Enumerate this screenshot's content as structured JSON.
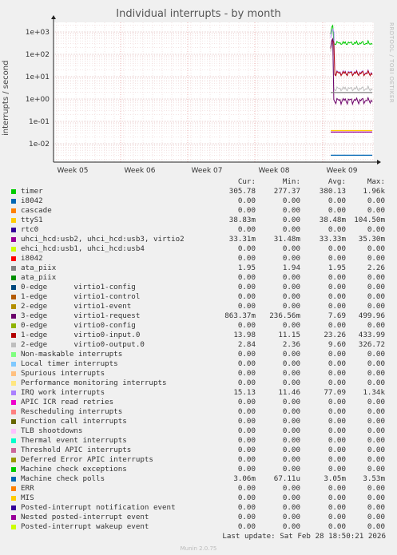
{
  "chart_data": {
    "type": "line",
    "title": "Individual interrupts - by month",
    "ylabel": "interrupts / second",
    "yscale": "log",
    "yticks": [
      "1e-02",
      "1e-01",
      "1e+00",
      "1e+01",
      "1e+02",
      "1e+03"
    ],
    "xticks": [
      "Week 05",
      "Week 06",
      "Week 07",
      "Week 08",
      "Week 09"
    ],
    "side_label": "RRDTOOL / TOBI OETIKER",
    "columns": [
      "Cur:",
      "Min:",
      "Avg:",
      "Max:"
    ],
    "series": [
      {
        "name": "timer",
        "color": "#00cc00",
        "cur": "305.78",
        "min": "277.37",
        "avg": "380.13",
        "max": "1.96k"
      },
      {
        "name": "i8042",
        "color": "#0066b3",
        "cur": "0.00",
        "min": "0.00",
        "avg": "0.00",
        "max": "0.00"
      },
      {
        "name": "cascade",
        "color": "#ff8000",
        "cur": "0.00",
        "min": "0.00",
        "avg": "0.00",
        "max": "0.00"
      },
      {
        "name": "ttyS1",
        "color": "#ffcc00",
        "cur": "38.83m",
        "min": "0.00",
        "avg": "38.48m",
        "max": "104.50m"
      },
      {
        "name": "rtc0",
        "color": "#330099",
        "cur": "0.00",
        "min": "0.00",
        "avg": "0.00",
        "max": "0.00"
      },
      {
        "name": "uhci_hcd:usb2, uhci_hcd:usb3, virtio2",
        "color": "#990099",
        "cur": "33.31m",
        "min": "31.48m",
        "avg": "33.33m",
        "max": "35.30m"
      },
      {
        "name": "ehci_hcd:usb1, uhci_hcd:usb4",
        "color": "#ccff00",
        "cur": "0.00",
        "min": "0.00",
        "avg": "0.00",
        "max": "0.00"
      },
      {
        "name": "i8042",
        "color": "#ff0000",
        "cur": "0.00",
        "min": "0.00",
        "avg": "0.00",
        "max": "0.00"
      },
      {
        "name": "ata_piix",
        "color": "#808080",
        "cur": "1.95",
        "min": "1.94",
        "avg": "1.95",
        "max": "2.26"
      },
      {
        "name": "ata_piix",
        "color": "#008f00",
        "cur": "0.00",
        "min": "0.00",
        "avg": "0.00",
        "max": "0.00"
      },
      {
        "name": "0-edge      virtio1-config",
        "color": "#00487d",
        "cur": "0.00",
        "min": "0.00",
        "avg": "0.00",
        "max": "0.00"
      },
      {
        "name": "1-edge      virtio1-control",
        "color": "#b35a00",
        "cur": "0.00",
        "min": "0.00",
        "avg": "0.00",
        "max": "0.00"
      },
      {
        "name": "2-edge      virtio1-event",
        "color": "#b38f00",
        "cur": "0.00",
        "min": "0.00",
        "avg": "0.00",
        "max": "0.00"
      },
      {
        "name": "3-edge      virtio1-request",
        "color": "#6b006b",
        "cur": "863.37m",
        "min": "236.56m",
        "avg": "7.69",
        "max": "499.96"
      },
      {
        "name": "0-edge      virtio0-config",
        "color": "#8fb300",
        "cur": "0.00",
        "min": "0.00",
        "avg": "0.00",
        "max": "0.00"
      },
      {
        "name": "1-edge      virtio0-input.0",
        "color": "#b30000",
        "cur": "13.98",
        "min": "11.15",
        "avg": "23.26",
        "max": "433.99"
      },
      {
        "name": "2-edge      virtio0-output.0",
        "color": "#bebebe",
        "cur": "2.84",
        "min": "2.36",
        "avg": "9.60",
        "max": "326.72"
      },
      {
        "name": "Non-maskable interrupts",
        "color": "#80ff80",
        "cur": "0.00",
        "min": "0.00",
        "avg": "0.00",
        "max": "0.00"
      },
      {
        "name": "Local timer interrupts",
        "color": "#80c9ff",
        "cur": "0.00",
        "min": "0.00",
        "avg": "0.00",
        "max": "0.00"
      },
      {
        "name": "Spurious interrupts",
        "color": "#ffc080",
        "cur": "0.00",
        "min": "0.00",
        "avg": "0.00",
        "max": "0.00"
      },
      {
        "name": "Performance monitoring interrupts",
        "color": "#ffe680",
        "cur": "0.00",
        "min": "0.00",
        "avg": "0.00",
        "max": "0.00"
      },
      {
        "name": "IRQ work interrupts",
        "color": "#aa80ff",
        "cur": "15.13",
        "min": "11.46",
        "avg": "77.09",
        "max": "1.34k"
      },
      {
        "name": "APIC ICR read retries",
        "color": "#ee00cc",
        "cur": "0.00",
        "min": "0.00",
        "avg": "0.00",
        "max": "0.00"
      },
      {
        "name": "Rescheduling interrupts",
        "color": "#ff8080",
        "cur": "0.00",
        "min": "0.00",
        "avg": "0.00",
        "max": "0.00"
      },
      {
        "name": "Function call interrupts",
        "color": "#666600",
        "cur": "0.00",
        "min": "0.00",
        "avg": "0.00",
        "max": "0.00"
      },
      {
        "name": "TLB shootdowns",
        "color": "#ffbfff",
        "cur": "0.00",
        "min": "0.00",
        "avg": "0.00",
        "max": "0.00"
      },
      {
        "name": "Thermal event interrupts",
        "color": "#00ffcc",
        "cur": "0.00",
        "min": "0.00",
        "avg": "0.00",
        "max": "0.00"
      },
      {
        "name": "Threshold APIC interrupts",
        "color": "#cc6699",
        "cur": "0.00",
        "min": "0.00",
        "avg": "0.00",
        "max": "0.00"
      },
      {
        "name": "Deferred Error APIC interrupts",
        "color": "#999900",
        "cur": "0.00",
        "min": "0.00",
        "avg": "0.00",
        "max": "0.00"
      },
      {
        "name": "Machine check exceptions",
        "color": "#00cc00",
        "cur": "0.00",
        "min": "0.00",
        "avg": "0.00",
        "max": "0.00"
      },
      {
        "name": "Machine check polls",
        "color": "#0066b3",
        "cur": "3.06m",
        "min": "67.11u",
        "avg": "3.05m",
        "max": "3.53m"
      },
      {
        "name": "ERR",
        "color": "#ff8000",
        "cur": "0.00",
        "min": "0.00",
        "avg": "0.00",
        "max": "0.00"
      },
      {
        "name": "MIS",
        "color": "#ffcc00",
        "cur": "0.00",
        "min": "0.00",
        "avg": "0.00",
        "max": "0.00"
      },
      {
        "name": "Posted-interrupt notification event",
        "color": "#330099",
        "cur": "0.00",
        "min": "0.00",
        "avg": "0.00",
        "max": "0.00"
      },
      {
        "name": "Nested posted-interrupt event",
        "color": "#990099",
        "cur": "0.00",
        "min": "0.00",
        "avg": "0.00",
        "max": "0.00"
      },
      {
        "name": "Posted-interrupt wakeup event",
        "color": "#ccff00",
        "cur": "0.00",
        "min": "0.00",
        "avg": "0.00",
        "max": "0.00"
      }
    ]
  },
  "footer": {
    "last_update": "Last update: Sat Feb 28 18:50:21 2026",
    "munin": "Munin 2.0.75"
  }
}
